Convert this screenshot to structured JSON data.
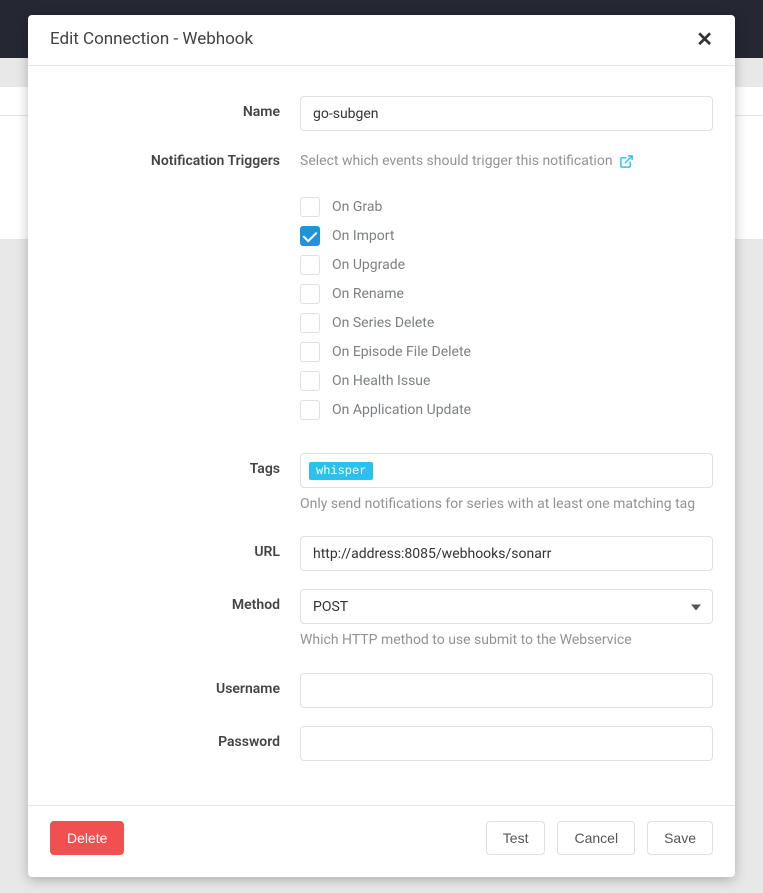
{
  "modal": {
    "title": "Edit Connection - Webhook"
  },
  "form": {
    "name": {
      "label": "Name",
      "value": "go-subgen"
    },
    "triggers": {
      "label": "Notification Triggers",
      "help": "Select which events should trigger this notification",
      "items": [
        {
          "label": "On Grab",
          "checked": false
        },
        {
          "label": "On Import",
          "checked": true
        },
        {
          "label": "On Upgrade",
          "checked": false
        },
        {
          "label": "On Rename",
          "checked": false
        },
        {
          "label": "On Series Delete",
          "checked": false
        },
        {
          "label": "On Episode File Delete",
          "checked": false
        },
        {
          "label": "On Health Issue",
          "checked": false
        },
        {
          "label": "On Application Update",
          "checked": false
        }
      ]
    },
    "tags": {
      "label": "Tags",
      "values": [
        "whisper"
      ],
      "help": "Only send notifications for series with at least one matching tag"
    },
    "url": {
      "label": "URL",
      "value": "http://address:8085/webhooks/sonarr"
    },
    "method": {
      "label": "Method",
      "value": "POST",
      "help": "Which HTTP method to use submit to the Webservice"
    },
    "username": {
      "label": "Username",
      "value": ""
    },
    "password": {
      "label": "Password",
      "value": ""
    }
  },
  "buttons": {
    "delete": "Delete",
    "test": "Test",
    "cancel": "Cancel",
    "save": "Save"
  }
}
